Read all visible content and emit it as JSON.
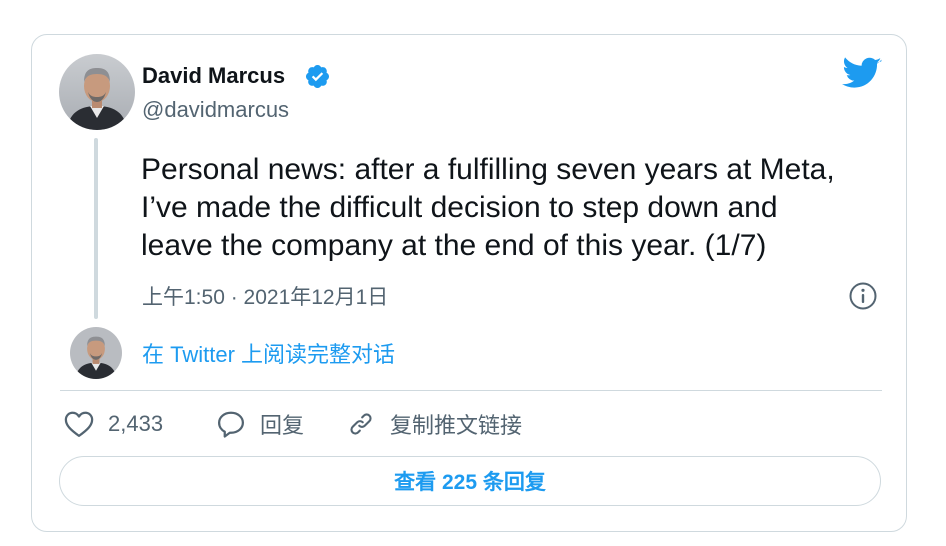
{
  "tweet": {
    "author_name": "David Marcus",
    "author_handle": "@davidmarcus",
    "verified_icon": "verified-badge-icon",
    "brand_icon": "twitter-bird-icon",
    "text": "Personal news: after a fulfilling seven years at Meta,\nI’ve made the difficult decision to step down and\nleave the company at the end of this year. (1/7)",
    "timestamp": "上午1:50 · 2021年12月1日"
  },
  "thread": {
    "read_conversation_label": "在 Twitter 上阅读完整对话"
  },
  "actions": {
    "like_count": "2,433",
    "reply_label": "回复",
    "copy_link_label": "复制推文链接"
  },
  "footer": {
    "view_replies_label": "查看 225 条回复"
  },
  "colors": {
    "accent": "#1d9bf0",
    "text_primary": "#0f1419",
    "text_secondary": "#536471",
    "border": "#cfd9de"
  }
}
